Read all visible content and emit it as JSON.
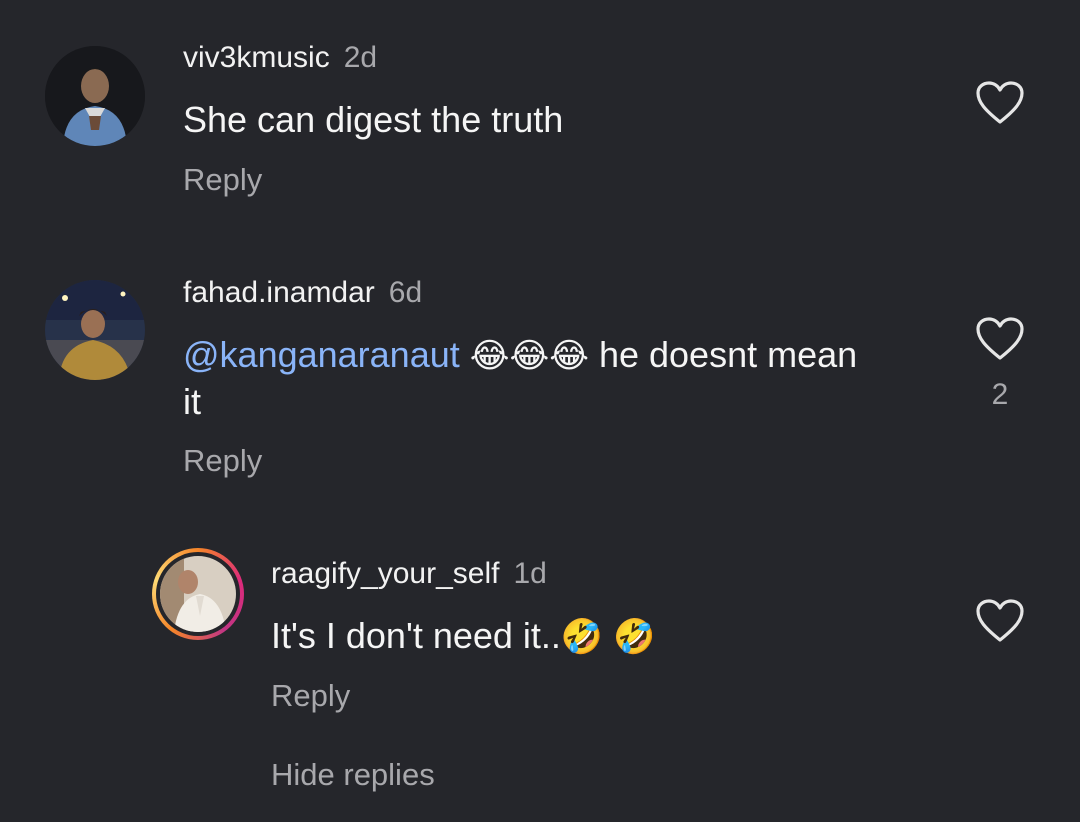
{
  "comments": [
    {
      "username": "viv3kmusic",
      "time": "2d",
      "text": "She can digest the truth",
      "reply_label": "Reply",
      "like_count": ""
    },
    {
      "username": "fahad.inamdar",
      "time": "6d",
      "mention": "@kanganaranaut",
      "emojis": "😂😂😂",
      "text_after": "he doesnt mean",
      "text_line2": "it",
      "reply_label": "Reply",
      "like_count": "2"
    }
  ],
  "replies": [
    {
      "username": "raagify_your_self",
      "time": "1d",
      "text": "It's I don't need it..",
      "emojis": [
        "🤣",
        "🤣"
      ],
      "reply_label": "Reply"
    }
  ],
  "hide_replies_label": "Hide replies",
  "colors": {
    "background": "#25262b",
    "muted": "#a8a8ac",
    "mention": "#8ab4f8"
  }
}
